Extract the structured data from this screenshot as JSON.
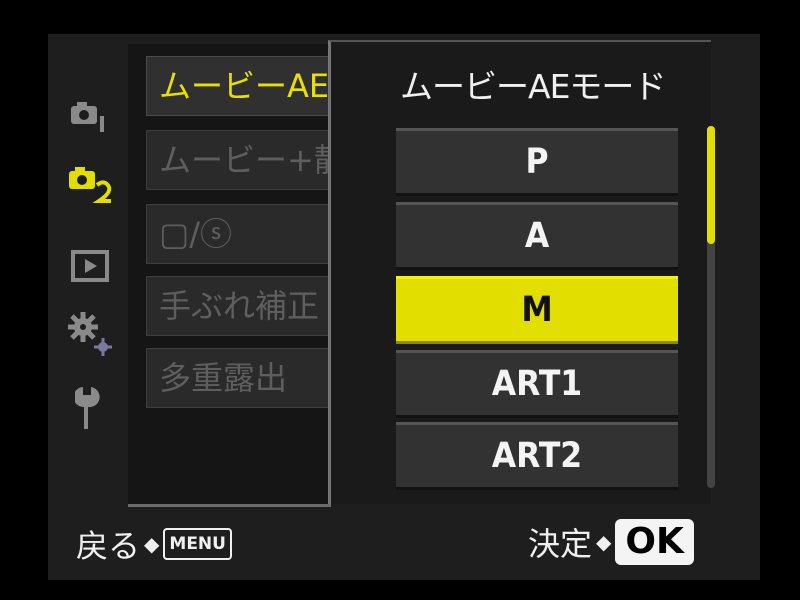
{
  "menu": {
    "items": [
      {
        "label": "ムービーAE"
      },
      {
        "label": "ムービー+静止"
      },
      {
        "label": "▢/ⓢ"
      },
      {
        "label": "手ぶれ補正"
      },
      {
        "label": "多重露出"
      }
    ]
  },
  "tabs": [
    "camera1-icon",
    "camera2-icon",
    "playback-icon",
    "custom-gear-icon",
    "setup-wrench-icon"
  ],
  "popup": {
    "title": "ムービーAEモード",
    "options": [
      "P",
      "A",
      "M",
      "ART1",
      "ART2"
    ],
    "selected": "M"
  },
  "footer": {
    "back_label": "戻る",
    "back_key": "MENU",
    "confirm_label": "決定",
    "confirm_key": "OK"
  },
  "colors": {
    "highlight": "#e2de00",
    "background": "#1e1e1e"
  }
}
